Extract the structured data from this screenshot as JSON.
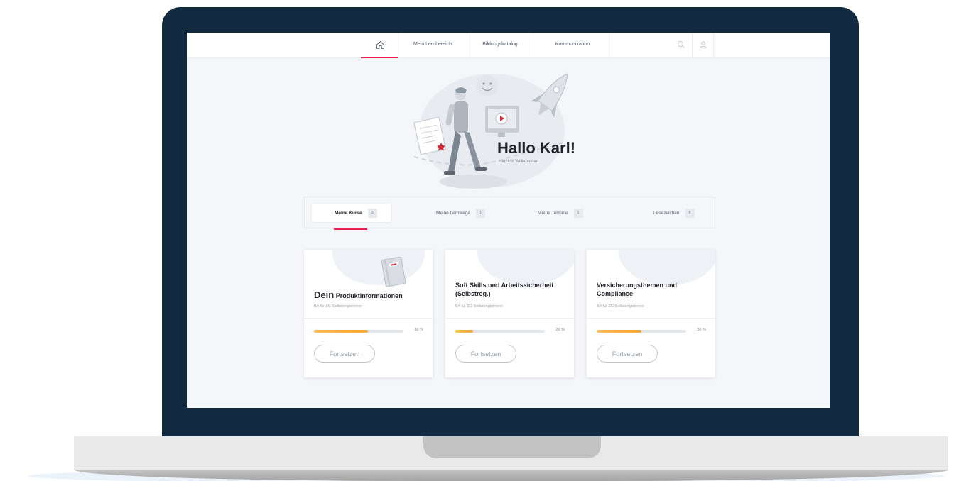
{
  "nav": {
    "home_icon": "home-icon",
    "items": [
      "Mein Lernbereich",
      "Bildungskatalog",
      "Kommunikation"
    ],
    "search_icon": "search-icon",
    "user_icon": "user-icon",
    "accent_color": "#e0234e"
  },
  "hero": {
    "title": "Hallo Karl!",
    "subtitle": "Herzlich Willkommen"
  },
  "tabs": [
    {
      "label": "Meine Kurse",
      "count": "3"
    },
    {
      "label": "Meine Lernwege",
      "count": "1"
    },
    {
      "label": "Meine Termine",
      "count": "1"
    },
    {
      "label": "Lesezeichen",
      "count": "8"
    }
  ],
  "courses": [
    {
      "title_lead": "Dein",
      "title_rest": "Produktinformationen",
      "subtitle": "BA für ZG Selbstregistrierer",
      "progress": 60,
      "progress_label": "60 %",
      "button": "Fortsetzen"
    },
    {
      "title_lead": "",
      "title_rest": "Soft Skills und Arbeitssicherheit (Selbstreg.)",
      "subtitle": "BA für ZG Selbstregistrierer",
      "progress": 20,
      "progress_label": "20 %",
      "button": "Fortsetzen"
    },
    {
      "title_lead": "",
      "title_rest": "Versicherungsthemen und Compliance",
      "subtitle": "BA für ZG Selbstregistrierer",
      "progress": 50,
      "progress_label": "50 %",
      "button": "Fortsetzen"
    }
  ],
  "colors": {
    "progress": "#f9a93b",
    "frame": "#122a40"
  }
}
